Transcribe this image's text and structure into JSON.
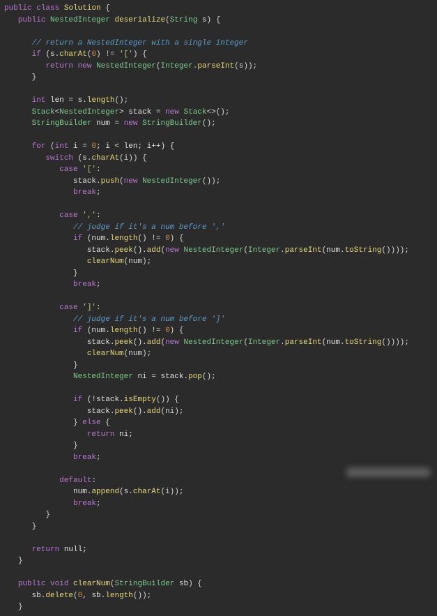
{
  "code": {
    "l01": {
      "kw1": "public",
      "kw2": "class",
      "name": "Solution",
      "p": " {"
    },
    "l02": {
      "kw1": "public",
      "type": "NestedInteger",
      "name": "deserialize",
      "p1": "(",
      "type2": "String",
      "arg": " s",
      "p2": ") {"
    },
    "l03": {
      "cmt": "// return a NestedInteger with a single integer"
    },
    "l04": {
      "kw": "if",
      "p1": " (s.",
      "m": "charAt",
      "p2": "(",
      "n": "0",
      "p3": ") != ",
      "s": "'['",
      "p4": ") {"
    },
    "l05": {
      "kw1": "return",
      "kw2": "new",
      "type": "NestedInteger",
      "p1": "(",
      "type2": "Integer",
      "p2": ".",
      "m": "parseInt",
      "p3": "(s));"
    },
    "l06": {
      "p": "}"
    },
    "l07": {
      "kw": "int",
      "id": " len = s.",
      "m": "length",
      "p": "();"
    },
    "l08": {
      "type1": "Stack",
      "p1": "<",
      "type2": "NestedInteger",
      "p2": "> stack = ",
      "kw": "new",
      "type3": " Stack",
      "p3": "<>();"
    },
    "l09": {
      "type1": "StringBuilder",
      "id": " num = ",
      "kw": "new",
      "type2": " StringBuilder",
      "p": "();"
    },
    "l10": {
      "kw1": "for",
      "p1": " (",
      "kw2": "int",
      "id": " i = ",
      "n1": "0",
      "p2": "; i < len; i++) {"
    },
    "l11": {
      "kw": "switch",
      "p1": " (s.",
      "m": "charAt",
      "p2": "(i)) {"
    },
    "l12": {
      "kw": "case",
      "s": " '['",
      "p": ":"
    },
    "l13": {
      "id": "stack.",
      "m": "push",
      "p1": "(",
      "kw": "new",
      "type": " NestedInteger",
      "p2": "());"
    },
    "l14": {
      "kw": "break",
      "p": ";"
    },
    "l15": {
      "kw": "case",
      "s": " ','",
      "p": ":"
    },
    "l16": {
      "cmt": "// judge if it's a num before ','"
    },
    "l17": {
      "kw": "if",
      "p1": " (num.",
      "m": "length",
      "p2": "() != ",
      "n": "0",
      "p3": ") {"
    },
    "l18": {
      "id1": "stack.",
      "m1": "peek",
      "p1": "().",
      "m2": "add",
      "p2": "(",
      "kw": "new",
      "type1": " NestedInteger",
      "p3": "(",
      "type2": "Integer",
      "p4": ".",
      "m3": "parseInt",
      "p5": "(num.",
      "m4": "toString",
      "p6": "())));"
    },
    "l19": {
      "m": "clearNum",
      "p": "(num);"
    },
    "l20": {
      "p": "}"
    },
    "l21": {
      "kw": "break",
      "p": ";"
    },
    "l22": {
      "kw": "case",
      "s": " ']'",
      "p": ":"
    },
    "l23": {
      "cmt": "// judge if it's a num before ']'"
    },
    "l24": {
      "kw": "if",
      "p1": " (num.",
      "m": "length",
      "p2": "() != ",
      "n": "0",
      "p3": ") {"
    },
    "l25": {
      "id1": "stack.",
      "m1": "peek",
      "p1": "().",
      "m2": "add",
      "p2": "(",
      "kw": "new",
      "type1": " NestedInteger",
      "p3": "(",
      "type2": "Integer",
      "p4": ".",
      "m3": "parseInt",
      "p5": "(num.",
      "m4": "toString",
      "p6": "())));"
    },
    "l26": {
      "m": "clearNum",
      "p": "(num);"
    },
    "l27": {
      "p": "}"
    },
    "l28": {
      "type": "NestedInteger",
      "id": " ni = stack.",
      "m": "pop",
      "p": "();"
    },
    "l29": {
      "kw": "if",
      "p1": " (!stack.",
      "m": "isEmpty",
      "p2": "()) {"
    },
    "l30": {
      "id": "stack.",
      "m1": "peek",
      "p1": "().",
      "m2": "add",
      "p2": "(ni);"
    },
    "l31": {
      "p1": "} ",
      "kw": "else",
      "p2": " {"
    },
    "l32": {
      "kw": "return",
      "id": " ni;"
    },
    "l33": {
      "p": "}"
    },
    "l34": {
      "kw": "break",
      "p": ";"
    },
    "l35": {
      "kw": "default",
      "p": ":"
    },
    "l36": {
      "id1": "num.",
      "m1": "append",
      "p1": "(s.",
      "m2": "charAt",
      "p2": "(i));"
    },
    "l37": {
      "kw": "break",
      "p": ";"
    },
    "l38": {
      "p": "}"
    },
    "l39": {
      "p": "}"
    },
    "l40": {
      "kw": "return",
      "id": " null;"
    },
    "l41": {
      "p": "}"
    },
    "l42": {
      "kw1": "public",
      "kw2": "void",
      "name": "clearNum",
      "p1": "(",
      "type": "StringBuilder",
      "id": " sb",
      "p2": ") {"
    },
    "l43": {
      "id": "sb.",
      "m1": "delete",
      "p1": "(",
      "n": "0",
      "p2": ", sb.",
      "m2": "length",
      "p3": "());"
    },
    "l44": {
      "p": "}"
    }
  }
}
